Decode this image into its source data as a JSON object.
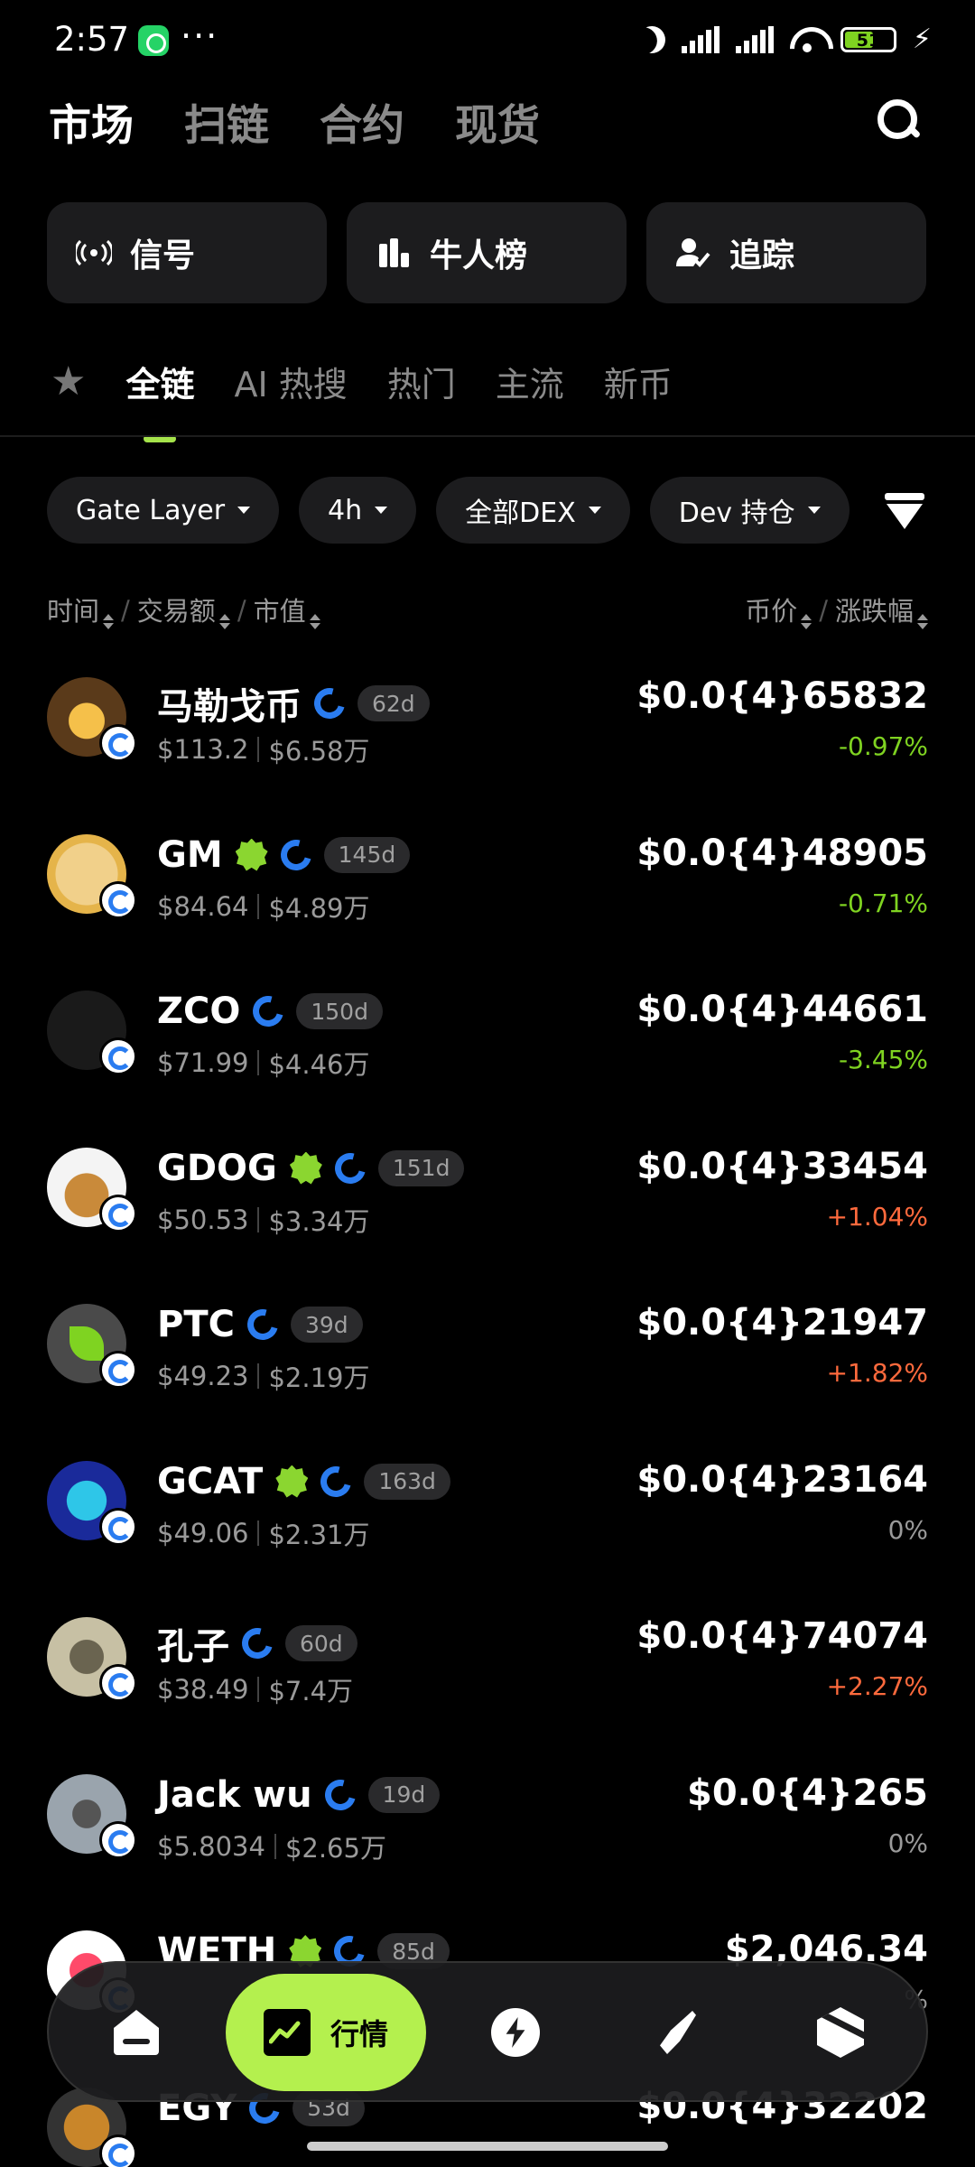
{
  "status_bar": {
    "time": "2:57",
    "dots": "···",
    "battery": "51",
    "icons": [
      "whatsapp-icon",
      "moon-icon",
      "signal-icon",
      "signal-roaming-icon",
      "wifi-icon",
      "battery-icon",
      "charging-icon"
    ]
  },
  "top_nav": {
    "tabs": [
      {
        "label": "市场",
        "active": true
      },
      {
        "label": "扫链",
        "active": false
      },
      {
        "label": "合约",
        "active": false
      },
      {
        "label": "现货",
        "active": false
      }
    ],
    "search_icon": "search-icon"
  },
  "features": [
    {
      "label": "信号",
      "icon": "broadcast-icon"
    },
    {
      "label": "牛人榜",
      "icon": "ranking-icon"
    },
    {
      "label": "追踪",
      "icon": "user-track-icon"
    }
  ],
  "tabs": {
    "star_icon": "star-icon",
    "items": [
      {
        "label": "全链",
        "active": true
      },
      {
        "label": "AI 热搜",
        "active": false
      },
      {
        "label": "热门",
        "active": false
      },
      {
        "label": "主流",
        "active": false
      },
      {
        "label": "新币",
        "active": false
      }
    ]
  },
  "filters": [
    {
      "label": "Gate Layer"
    },
    {
      "label": "4h"
    },
    {
      "label": "全部DEX"
    },
    {
      "label": "Dev 持仓"
    }
  ],
  "sort_header": {
    "time": "时间",
    "volume": "交易额",
    "market_cap": "市值",
    "price": "币价",
    "change": "涨跌幅",
    "separator": "/"
  },
  "tokens": [
    {
      "name": "马勒戈币",
      "verified": false,
      "age": "62d",
      "volume": "$113.2",
      "market_cap": "$6.58万",
      "price": "$0.0{4}65832",
      "change": "-0.97%",
      "direction": "neg"
    },
    {
      "name": "GM",
      "verified": true,
      "age": "145d",
      "volume": "$84.64",
      "market_cap": "$4.89万",
      "price": "$0.0{4}48905",
      "change": "-0.71%",
      "direction": "neg"
    },
    {
      "name": "ZCO",
      "verified": false,
      "age": "150d",
      "volume": "$71.99",
      "market_cap": "$4.46万",
      "price": "$0.0{4}44661",
      "change": "-3.45%",
      "direction": "neg"
    },
    {
      "name": "GDOG",
      "verified": true,
      "age": "151d",
      "volume": "$50.53",
      "market_cap": "$3.34万",
      "price": "$0.0{4}33454",
      "change": "+1.04%",
      "direction": "pos"
    },
    {
      "name": "PTC",
      "verified": false,
      "age": "39d",
      "volume": "$49.23",
      "market_cap": "$2.19万",
      "price": "$0.0{4}21947",
      "change": "+1.82%",
      "direction": "pos"
    },
    {
      "name": "GCAT",
      "verified": true,
      "age": "163d",
      "volume": "$49.06",
      "market_cap": "$2.31万",
      "price": "$0.0{4}23164",
      "change": "0%",
      "direction": "zero"
    },
    {
      "name": "孔子",
      "verified": false,
      "age": "60d",
      "volume": "$38.49",
      "market_cap": "$7.4万",
      "price": "$0.0{4}74074",
      "change": "+2.27%",
      "direction": "pos"
    },
    {
      "name": "Jack wu",
      "verified": false,
      "age": "19d",
      "volume": "$5.8034",
      "market_cap": "$2.65万",
      "price": "$0.0{4}265",
      "change": "0%",
      "direction": "zero"
    },
    {
      "name": "WETH",
      "verified": true,
      "age": "85d",
      "volume": "",
      "market_cap": "",
      "price": "$2,046.34",
      "change": "%",
      "direction": "zero"
    },
    {
      "name": "EGY",
      "verified": false,
      "age": "53d",
      "volume": "",
      "market_cap": "",
      "price": "$0.0{4}32202",
      "change": "",
      "direction": "zero"
    }
  ],
  "bottom_nav": {
    "items": [
      {
        "icon": "home-icon"
      },
      {
        "icon": "chart-icon",
        "label": "行情",
        "active": true
      },
      {
        "icon": "lightning-icon"
      },
      {
        "icon": "rocket-icon"
      },
      {
        "icon": "cube-icon"
      }
    ]
  },
  "colors": {
    "accent": "#b4f04e",
    "negative": "#7fd321",
    "positive": "#ff6a3d",
    "neutral": "#9a9a9a",
    "chain_blue": "#2a7cf0"
  }
}
